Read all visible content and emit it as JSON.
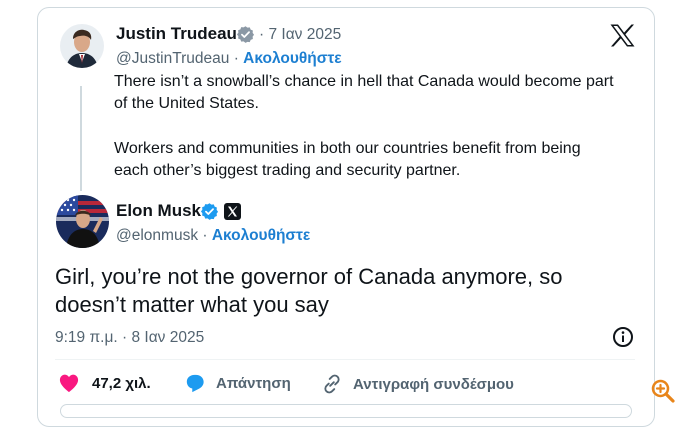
{
  "quoted_tweet": {
    "author_name": "Justin Trudeau",
    "date": "· 7 Ιαν 2025",
    "handle": "@JustinTrudeau ·",
    "follow_label": "Ακολουθήστε",
    "text_line1": "There isn’t a snowball’s chance in hell that Canada would become part",
    "text_line2": "of the United States.",
    "text_line3": "Workers and communities in both our countries benefit from being",
    "text_line4": "each other’s biggest trading and security partner."
  },
  "reply_tweet": {
    "author_name": "Elon Musk",
    "handle": "@elonmusk ·",
    "follow_label": "Ακολουθήστε",
    "text_line1": "Girl, you’re not the governor of Canada anymore, so",
    "text_line2": "doesn’t matter what you say",
    "timestamp": "9:19 π.μ. · 8 Ιαν 2025"
  },
  "actions": {
    "likes": "47,2 χιλ.",
    "reply": "Απάντηση",
    "copy_link": "Αντιγραφή συνδέσμου"
  },
  "colors": {
    "accent_blue": "#1d9bf0",
    "like_pink": "#f91880",
    "text_gray": "#536471",
    "zoom_orange": "#e8851a"
  },
  "icons": [
    "x-logo-icon",
    "verified-badge-icon",
    "info-icon",
    "heart-icon",
    "reply-bubble-icon",
    "link-icon",
    "zoom-in-icon"
  ]
}
